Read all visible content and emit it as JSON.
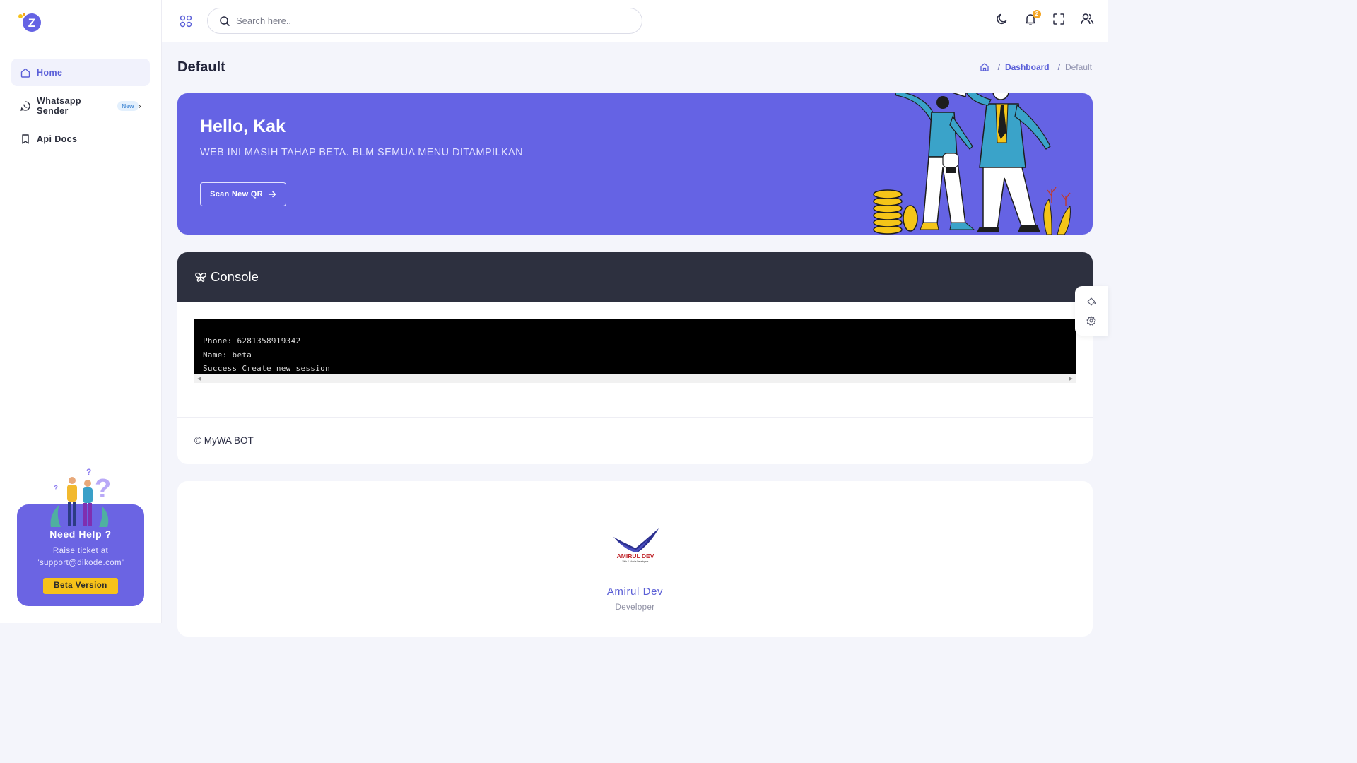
{
  "sidebar": {
    "logo_letter": "Z",
    "items": [
      {
        "label": "Home",
        "icon": "home-icon",
        "active": true
      },
      {
        "label": "Whatsapp Sender",
        "icon": "whatsapp-icon",
        "badge": "New"
      },
      {
        "label": "Api Docs",
        "icon": "bookmark-icon"
      }
    ],
    "help": {
      "title": "Need Help ?",
      "text": "Raise ticket at \"support@dikode.com\"",
      "button": "Beta Version"
    }
  },
  "topbar": {
    "search_placeholder": "Search here..",
    "notification_count": "2"
  },
  "page": {
    "title": "Default",
    "breadcrumb": {
      "link": "Dashboard",
      "current": "Default"
    }
  },
  "hero": {
    "title": "Hello, Kak",
    "subtitle": "WEB INI MASIH TAHAP BETA. BLM SEMUA MENU DITAMPILKAN",
    "button": "Scan New QR"
  },
  "console": {
    "title": "Console",
    "lines": [
      "Phone: 6281358919342",
      "Name: beta",
      "Success Create new session"
    ],
    "footer": "© MyWA BOT"
  },
  "developer": {
    "logo_text": "AMIRUL DEV",
    "logo_tagline": "Web & Mobile Developers",
    "name": "Amirul Dev",
    "role": "Developer"
  },
  "colors": {
    "primary": "#6563e4",
    "console_header": "#2d303f",
    "terminal_bg": "#000000",
    "accent_yellow": "#f7c21a"
  }
}
